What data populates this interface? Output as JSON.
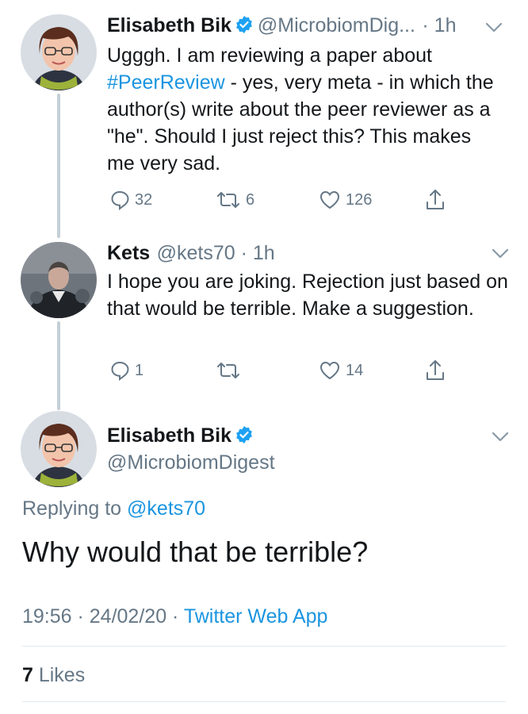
{
  "tweet1": {
    "name": "Elisabeth Bik",
    "handle": "@MicrobiomDig...",
    "time": "· 1h",
    "text_before": "Ugggh. I am reviewing a paper about ",
    "hashtag": "#PeerReview",
    "text_after": " - yes, very meta - in which the author(s) write about the peer reviewer as a \"he\". Should I just reject this? This makes me very sad.",
    "replies": "32",
    "retweets": "6",
    "likes": "126"
  },
  "tweet2": {
    "name": "Kets",
    "handle": "@kets70 · 1h",
    "text": "I hope you are joking. Rejection just based on that would be terrible. Make a suggestion.",
    "replies": "1",
    "retweets": "",
    "likes": "14"
  },
  "main_tweet": {
    "name": "Elisabeth Bik",
    "handle": "@MicrobiomDigest",
    "replying_prefix": "Replying to ",
    "replying_handle": "@kets70",
    "text": "Why would that be terrible?",
    "timestamp": "19:56 · 24/02/20 · ",
    "source": "Twitter Web App",
    "likes_count": "7",
    "likes_label": " Likes"
  },
  "colors": {
    "link_blue": "#1b95e0",
    "muted_gray": "#657786",
    "divider": "#e1e8ed"
  },
  "icons": [
    "verified-badge-icon",
    "chevron-down-icon",
    "reply-icon",
    "retweet-icon",
    "heart-icon",
    "share-icon"
  ]
}
